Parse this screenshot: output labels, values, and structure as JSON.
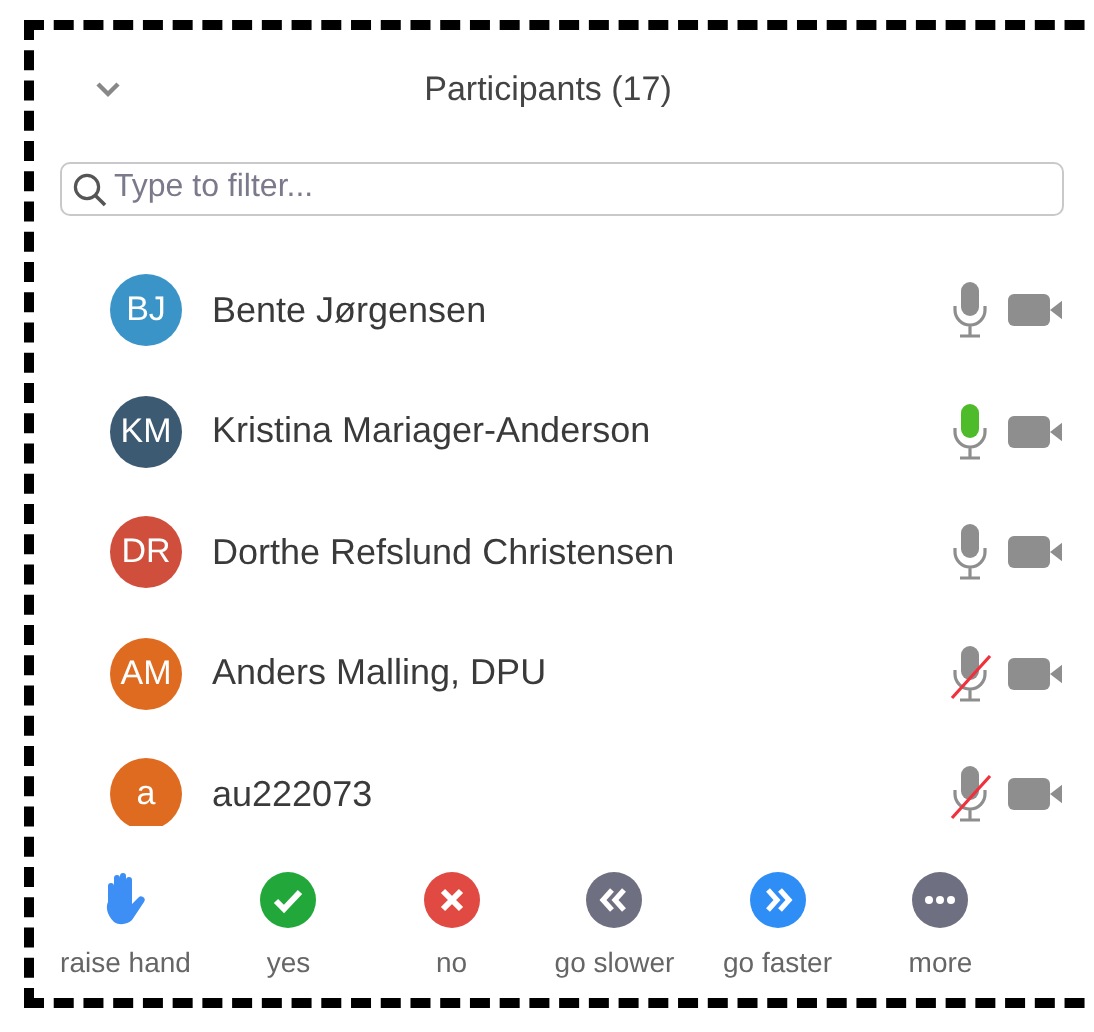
{
  "header": {
    "title": "Participants (17)",
    "collapsed": false
  },
  "search": {
    "placeholder": "Type to filter..."
  },
  "participants": [
    {
      "initials": "BJ",
      "name": "Bente Jørgensen",
      "color": "#3a94c8",
      "speaking": false,
      "muted": false
    },
    {
      "initials": "KM",
      "name": "Kristina Mariager-Anderson",
      "color": "#3d5a73",
      "speaking": true,
      "muted": false
    },
    {
      "initials": "DR",
      "name": "Dorthe Refslund Christensen",
      "color": "#cf4e3c",
      "speaking": false,
      "muted": false
    },
    {
      "initials": "AM",
      "name": "Anders Malling, DPU",
      "color": "#de6b1f",
      "speaking": false,
      "muted": true
    },
    {
      "initials": "a",
      "name": "au222073",
      "color": "#de6b1f",
      "speaking": false,
      "muted": true
    }
  ],
  "reactions": [
    {
      "kind": "hand",
      "label": "raise hand"
    },
    {
      "kind": "yes",
      "label": "yes"
    },
    {
      "kind": "no",
      "label": "no"
    },
    {
      "kind": "slower",
      "label": "go slower"
    },
    {
      "kind": "faster",
      "label": "go faster"
    },
    {
      "kind": "more",
      "label": "more"
    }
  ]
}
